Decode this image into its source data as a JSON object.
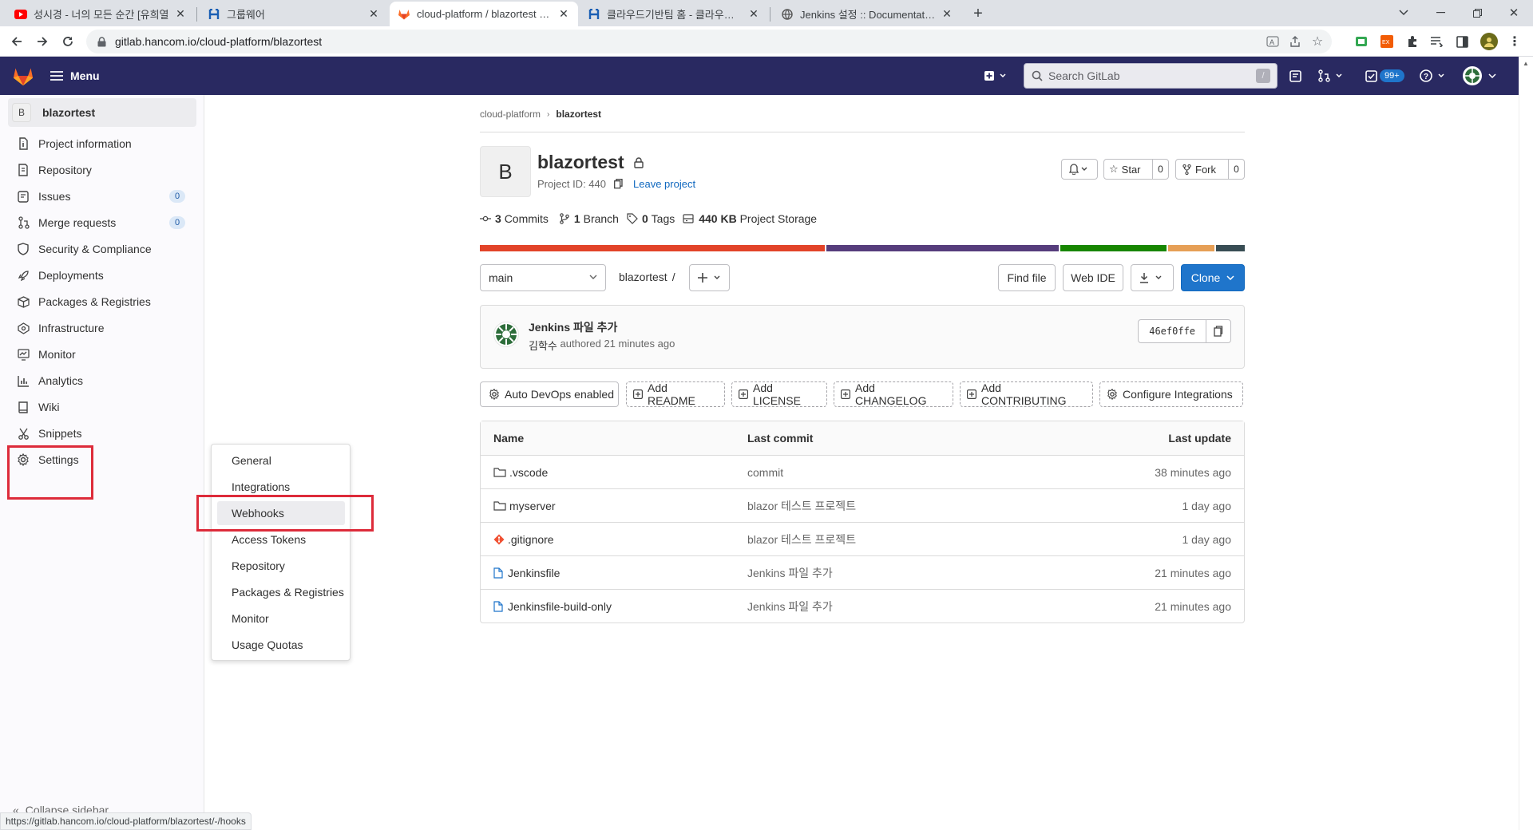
{
  "browser": {
    "tabs": [
      {
        "title": "성시경 - 너의 모든 순간 [유희열",
        "icon": "youtube-icon"
      },
      {
        "title": "그룹웨어",
        "icon": "hancom-icon"
      },
      {
        "title": "cloud-platform / blazortest · Git",
        "icon": "gitlab-icon",
        "active": true
      },
      {
        "title": "클라우드기반팀 홈 - 클라우드기",
        "icon": "hancom-icon"
      },
      {
        "title": "Jenkins 설정 :: Documentation f",
        "icon": "globe-icon"
      }
    ],
    "url": "gitlab.hancom.io/cloud-platform/blazortest",
    "status_url": "https://gitlab.hancom.io/cloud-platform/blazortest/-/hooks"
  },
  "header": {
    "menu_label": "Menu",
    "search_placeholder": "Search GitLab",
    "search_shortcut": "/",
    "todo_count": "99+"
  },
  "sidebar": {
    "project_initial": "B",
    "project_name": "blazortest",
    "items": [
      {
        "label": "Project information",
        "icon": "info-icon"
      },
      {
        "label": "Repository",
        "icon": "doc-icon"
      },
      {
        "label": "Issues",
        "icon": "issues-icon",
        "count": "0"
      },
      {
        "label": "Merge requests",
        "icon": "merge-icon",
        "count": "0"
      },
      {
        "label": "Security & Compliance",
        "icon": "shield-icon"
      },
      {
        "label": "Deployments",
        "icon": "rocket-icon"
      },
      {
        "label": "Packages & Registries",
        "icon": "package-icon"
      },
      {
        "label": "Infrastructure",
        "icon": "cloud-icon"
      },
      {
        "label": "Monitor",
        "icon": "monitor-icon"
      },
      {
        "label": "Analytics",
        "icon": "chart-icon"
      },
      {
        "label": "Wiki",
        "icon": "book-icon"
      },
      {
        "label": "Snippets",
        "icon": "scissors-icon"
      },
      {
        "label": "Settings",
        "icon": "gear-icon"
      }
    ],
    "collapse_label": "Collapse sidebar"
  },
  "settings_flyout": {
    "items": [
      "General",
      "Integrations",
      "Webhooks",
      "Access Tokens",
      "Repository",
      "Packages & Registries",
      "Monitor",
      "Usage Quotas"
    ],
    "highlighted": "Webhooks"
  },
  "breadcrumb": {
    "group": "cloud-platform",
    "project": "blazortest"
  },
  "project": {
    "avatar_letter": "B",
    "name": "blazortest",
    "id_label": "Project ID: 440",
    "leave_label": "Leave project",
    "star_label": "Star",
    "star_count": "0",
    "fork_label": "Fork",
    "fork_count": "0",
    "stats": {
      "commits_num": "3",
      "commits_label": "Commits",
      "branch_num": "1",
      "branch_label": "Branch",
      "tags_num": "0",
      "tags_label": "Tags",
      "storage_num": "440 KB",
      "storage_label": "Project Storage"
    },
    "language_colors": [
      "#e24329",
      "#563d7c",
      "#178600",
      "#e69f56",
      "#384d54"
    ]
  },
  "repo_bar": {
    "branch": "main",
    "path": "blazortest",
    "path_sep": "/",
    "find_file": "Find file",
    "web_ide": "Web IDE",
    "clone": "Clone"
  },
  "last_commit": {
    "title": "Jenkins 파일 추가",
    "author": "김학수",
    "meta": "authored 21 minutes ago",
    "sha": "46ef0ffe"
  },
  "action_buttons": [
    "Auto DevOps enabled",
    "Add README",
    "Add LICENSE",
    "Add CHANGELOG",
    "Add CONTRIBUTING",
    "Configure Integrations"
  ],
  "file_table": {
    "headers": [
      "Name",
      "Last commit",
      "Last update"
    ],
    "rows": [
      {
        "name": ".vscode",
        "type": "folder",
        "commit": "commit",
        "updated": "38 minutes ago"
      },
      {
        "name": "myserver",
        "type": "folder",
        "commit": "blazor 테스트 프로젝트",
        "updated": "1 day ago"
      },
      {
        "name": ".gitignore",
        "type": "git",
        "commit": "blazor 테스트 프로젝트",
        "updated": "1 day ago"
      },
      {
        "name": "Jenkinsfile",
        "type": "file",
        "commit": "Jenkins 파일 추가",
        "updated": "21 minutes ago"
      },
      {
        "name": "Jenkinsfile-build-only",
        "type": "file",
        "commit": "Jenkins 파일 추가",
        "updated": "21 minutes ago"
      }
    ]
  },
  "colors": {
    "header": "#292961",
    "link": "#1068bf",
    "clone": "#1f75cb",
    "annotation": "#dd2b3a"
  }
}
